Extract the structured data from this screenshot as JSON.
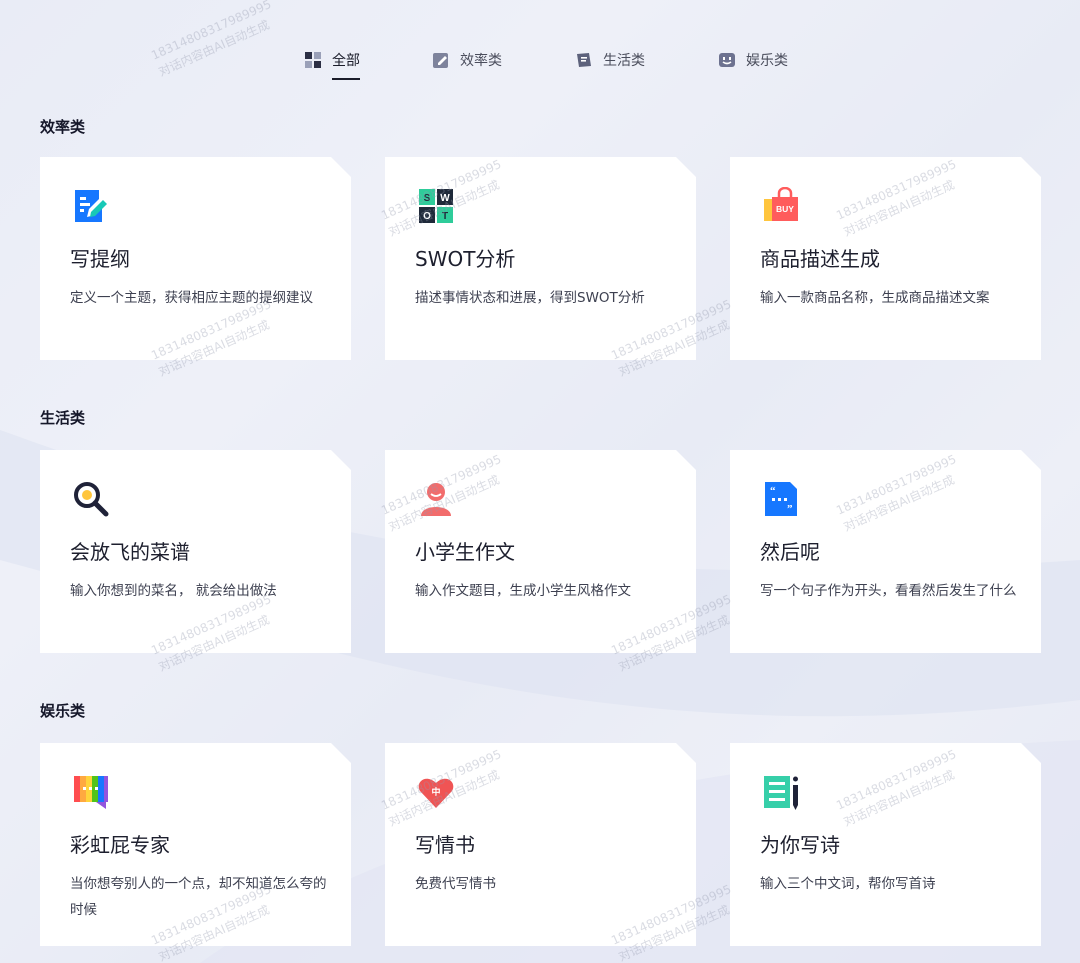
{
  "tabs": [
    {
      "label": "全部",
      "icon": "grid-icon",
      "active": true
    },
    {
      "label": "效率类",
      "icon": "edit-icon",
      "active": false
    },
    {
      "label": "生活类",
      "icon": "note-icon",
      "active": false
    },
    {
      "label": "娱乐类",
      "icon": "smile-icon",
      "active": false
    }
  ],
  "sections": [
    {
      "title": "效率类",
      "cards": [
        {
          "title": "写提纲",
          "desc": "定义一个主题，获得相应主题的提纲建议",
          "icon": "outline-doc-icon"
        },
        {
          "title": "SWOT分析",
          "desc": "描述事情状态和进展，得到SWOT分析",
          "icon": "swot-icon"
        },
        {
          "title": "商品描述生成",
          "desc": "输入一款商品名称，生成商品描述文案",
          "icon": "buy-bag-icon"
        }
      ]
    },
    {
      "title": "生活类",
      "cards": [
        {
          "title": "会放飞的菜谱",
          "desc": "输入你想到的菜名， 就会给出做法",
          "icon": "magnifier-egg-icon"
        },
        {
          "title": "小学生作文",
          "desc": "输入作文题目，生成小学生风格作文",
          "icon": "student-icon"
        },
        {
          "title": "然后呢",
          "desc": "写一个句子作为开头，看看然后发生了什么",
          "icon": "quote-doc-icon"
        }
      ]
    },
    {
      "title": "娱乐类",
      "cards": [
        {
          "title": "彩虹屁专家",
          "desc": "当你想夸别人的一个点，却不知道怎么夸的时候",
          "icon": "rainbow-chat-icon"
        },
        {
          "title": "写情书",
          "desc": "免费代写情书",
          "icon": "heart-icon"
        },
        {
          "title": "为你写诗",
          "desc": "输入三个中文词，帮你写首诗",
          "icon": "poem-pen-icon"
        }
      ]
    }
  ],
  "watermark": {
    "line1": "18314808317989995",
    "line2": "对话内容由AI自动生成"
  },
  "colors": {
    "accent_blue": "#1677ff",
    "active_tab": "#1a1c2a",
    "card_bg": "#ffffff"
  }
}
